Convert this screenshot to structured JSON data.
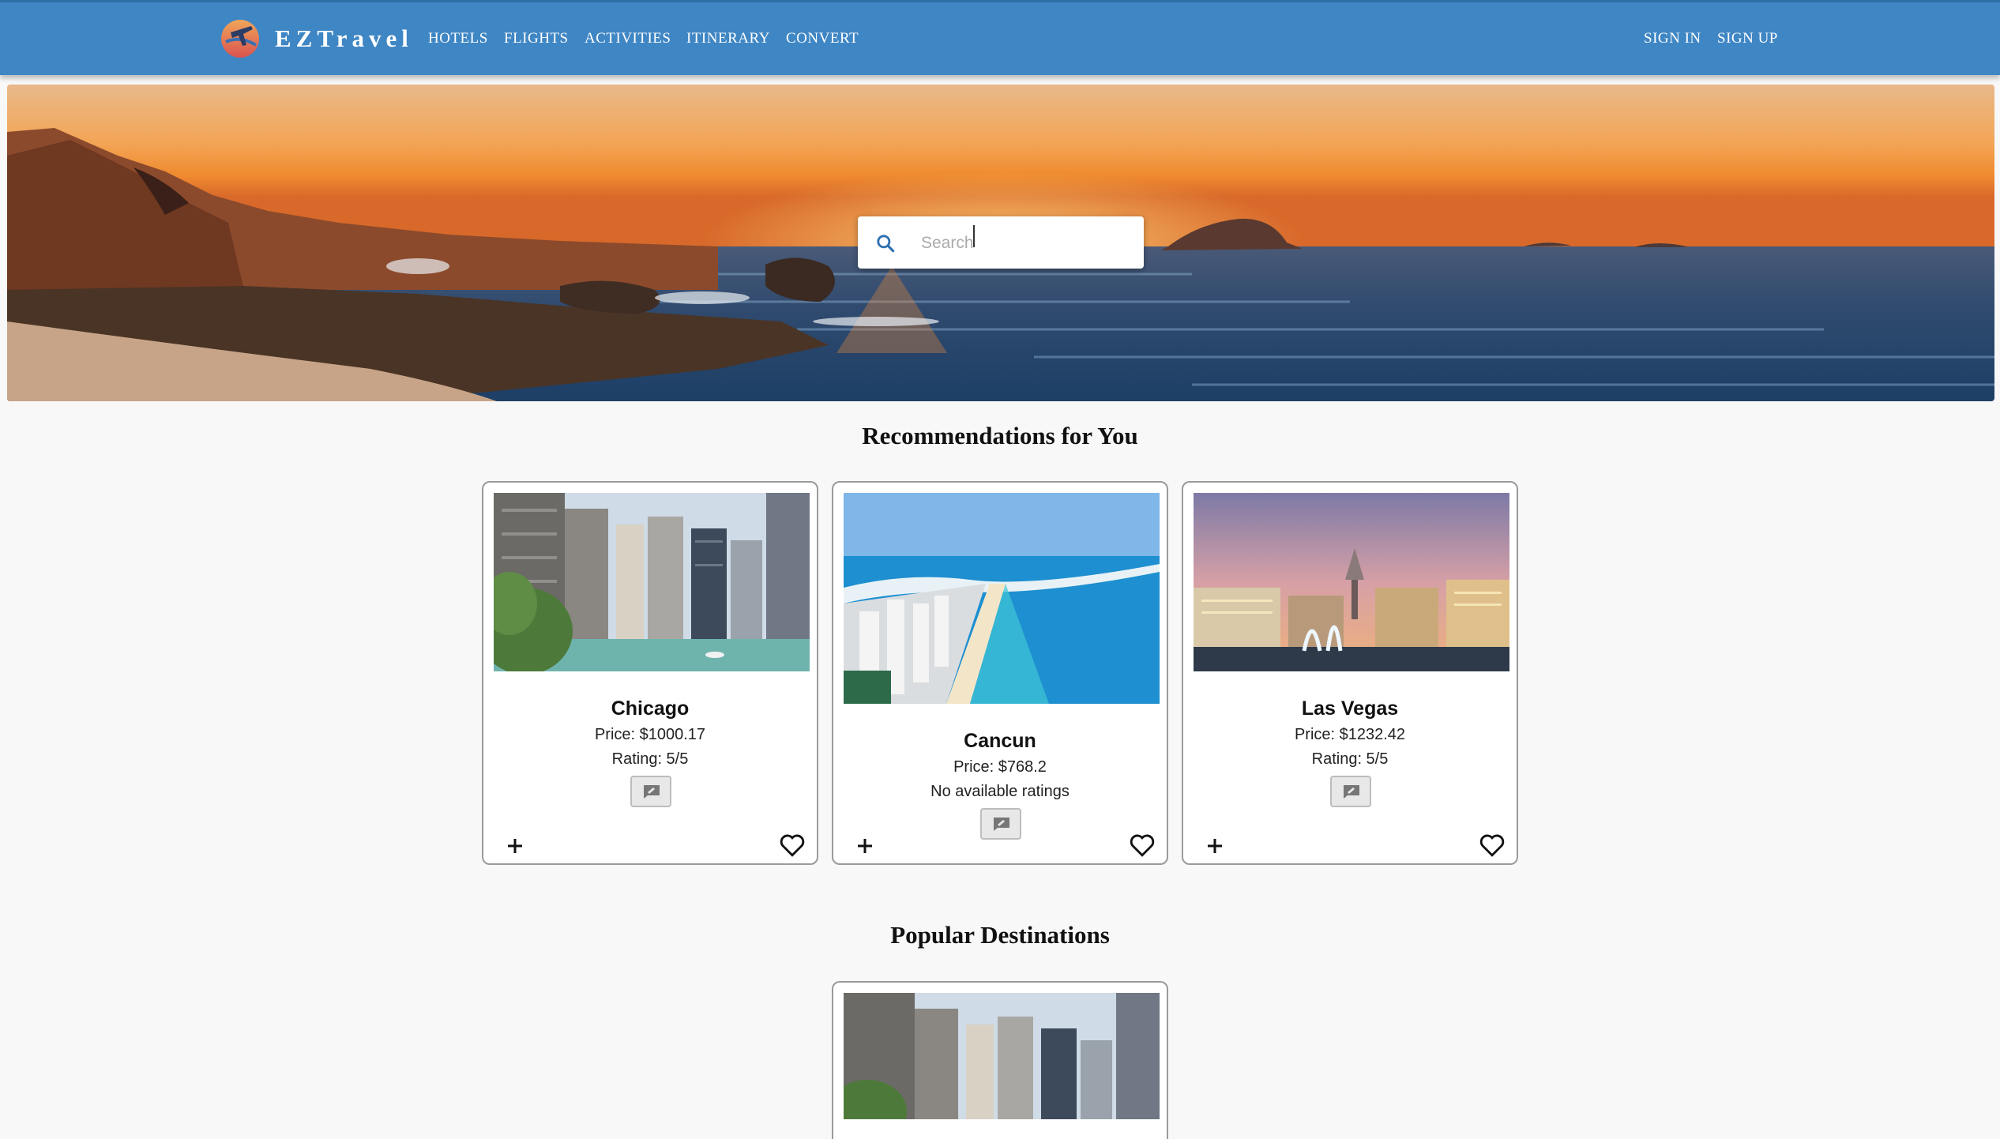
{
  "header": {
    "brand": "EZTravel",
    "nav": [
      "HOTELS",
      "FLIGHTS",
      "ACTIVITIES",
      "ITINERARY",
      "CONVERT"
    ],
    "auth": {
      "sign_in": "SIGN IN",
      "sign_up": "SIGN UP"
    }
  },
  "search": {
    "placeholder": "Search",
    "value": ""
  },
  "recommendations": {
    "title": "Recommendations for You",
    "cards": [
      {
        "name": "Chicago",
        "price": "Price: $1000.17",
        "rating": "Rating: 5/5"
      },
      {
        "name": "Cancun",
        "price": "Price: $768.2",
        "rating": "No available ratings"
      },
      {
        "name": "Las Vegas",
        "price": "Price: $1232.42",
        "rating": "Rating: 5/5"
      }
    ]
  },
  "popular": {
    "title": "Popular Destinations"
  },
  "icons": {
    "logo": "airplane-globe-icon",
    "search": "search-icon",
    "review": "review-icon",
    "add": "plus-icon",
    "favorite": "heart-outline-icon"
  },
  "colors": {
    "header": "#3f86c4",
    "search_icon": "#2d6fb0",
    "page_bg": "#f8f8f8"
  }
}
